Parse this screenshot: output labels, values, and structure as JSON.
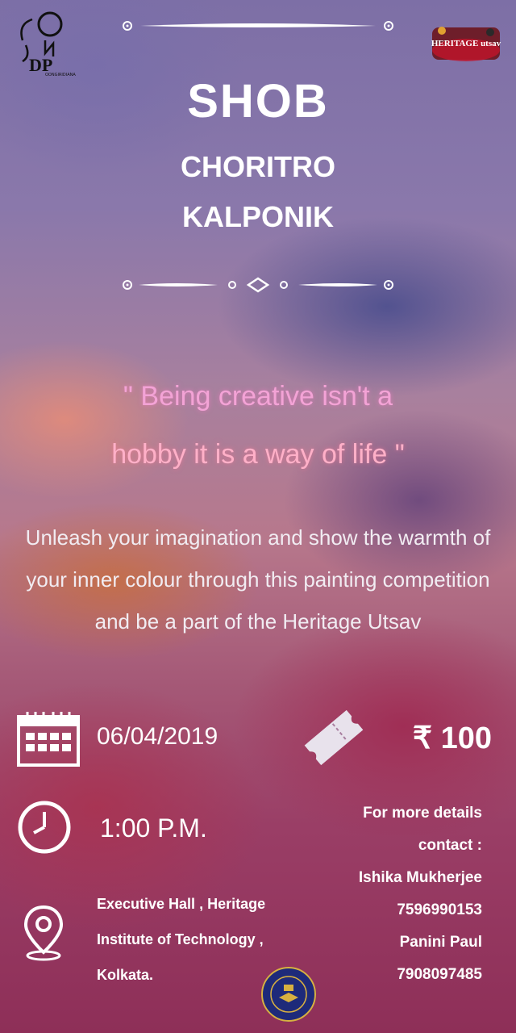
{
  "branding": {
    "left_logo_text": "DP",
    "left_logo_subtext": "OONGIRIDIANA",
    "right_logo_text": "HERITAGE utsav"
  },
  "title": {
    "line1": "SHOB",
    "line2": "CHORITRO",
    "line3": "KALPONIK"
  },
  "quote": {
    "line1": "\" Being creative isn't a",
    "line2": "hobby it is a way of life \""
  },
  "description": "Unleash your imagination and show the warmth of your inner colour through this painting competition and be a part of the Heritage Utsav",
  "event": {
    "date": "06/04/2019",
    "price": "₹ 100",
    "time": "1:00 P.M.",
    "venue_line1": "Executive Hall , Heritage",
    "venue_line2": "Institute of Technology ,",
    "venue_line3": "Kolkata."
  },
  "contact": {
    "heading1": "For more details",
    "heading2": "contact :",
    "name1": "Ishika Mukherjee",
    "phone1": "7596990153",
    "name2": "Panini Paul",
    "phone2": "7908097485"
  },
  "seal": {
    "text": "HERITAGE INSTITUTE OF TECHNOLOGY KOLKATA"
  },
  "icons": {
    "calendar": "calendar-icon",
    "ticket": "ticket-icon",
    "clock": "clock-icon",
    "location": "location-pin-icon"
  }
}
